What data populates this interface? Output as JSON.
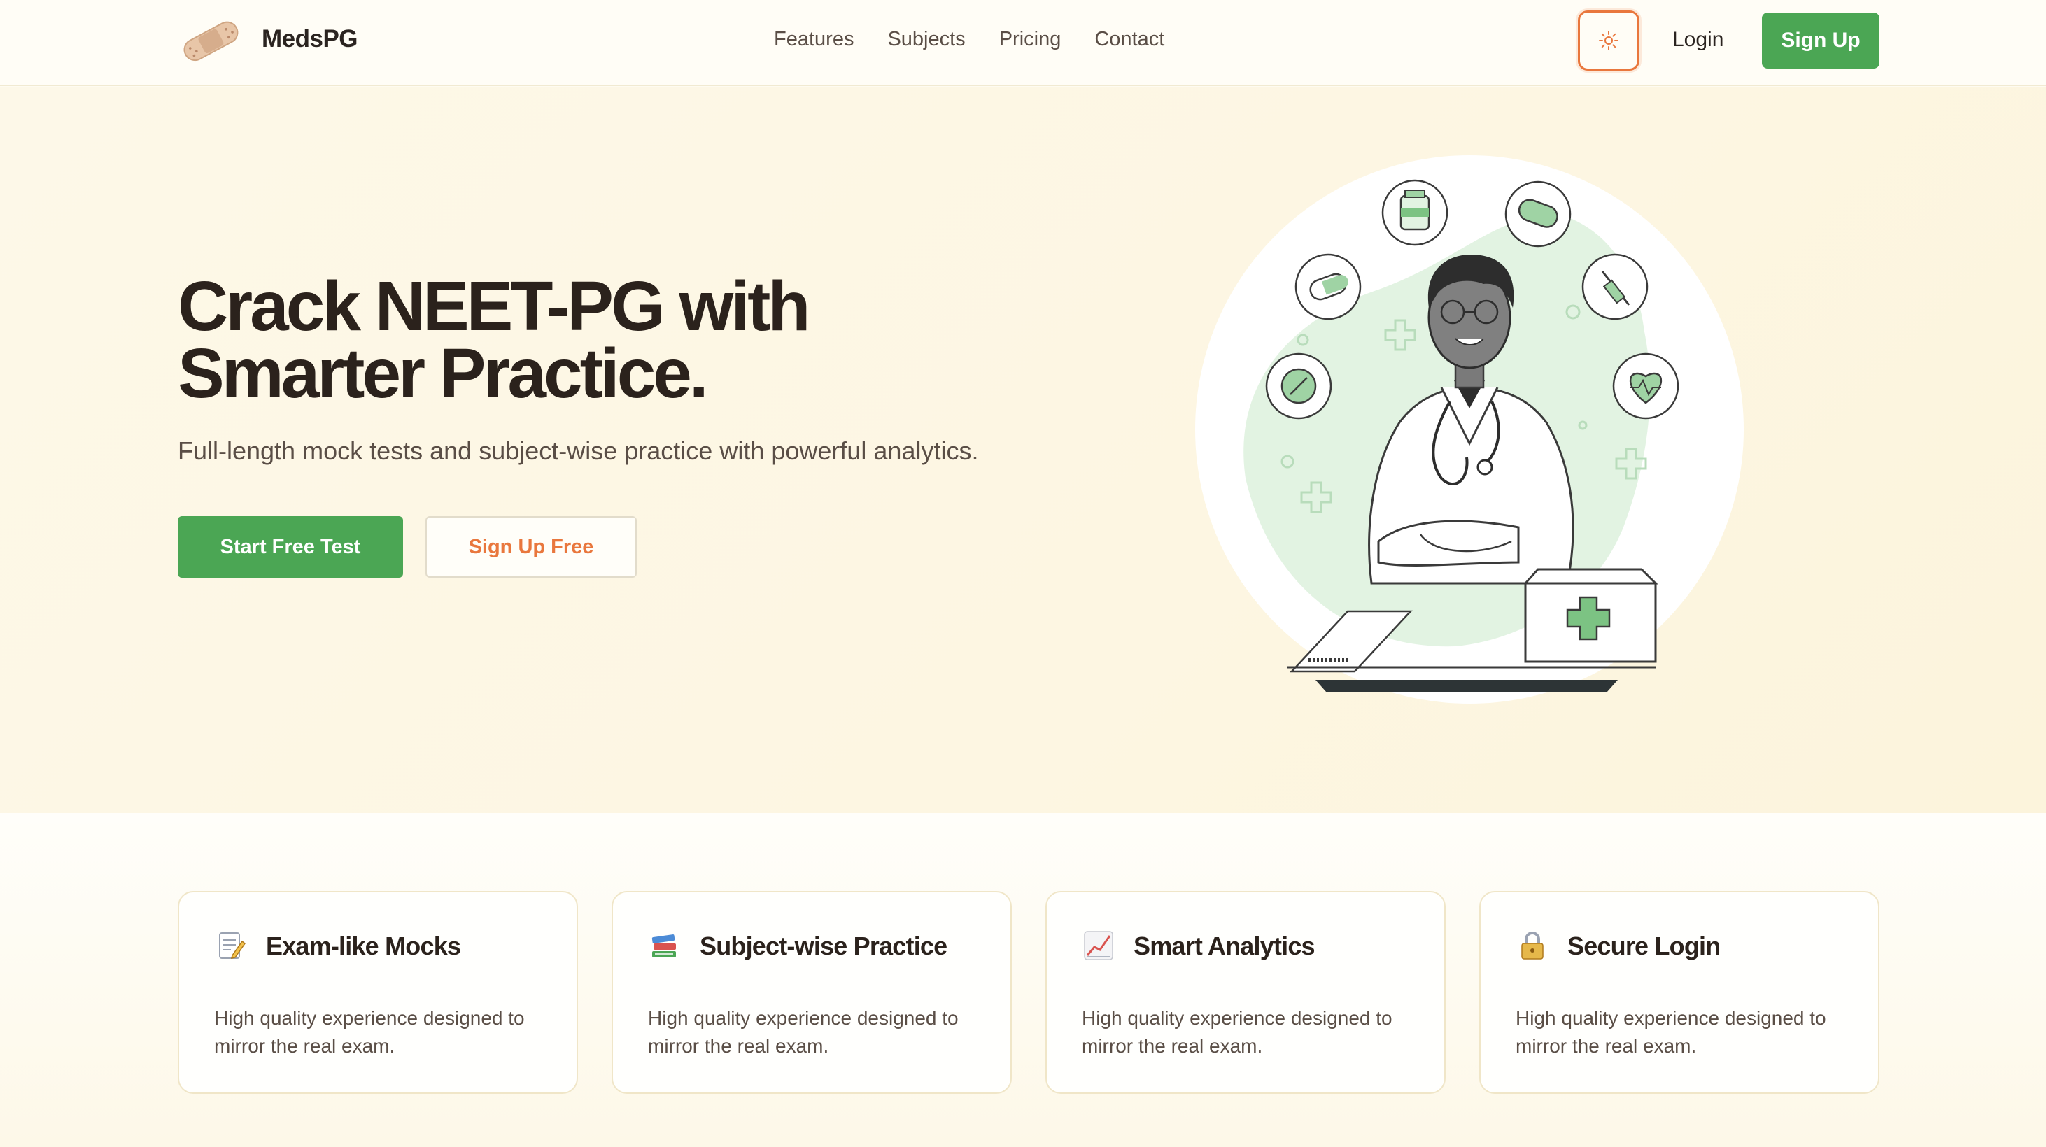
{
  "nav": {
    "brand": "MedsPG",
    "links": [
      "Features",
      "Subjects",
      "Pricing",
      "Contact"
    ],
    "login": "Login",
    "signup": "Sign Up",
    "theme_icon": "sun-icon"
  },
  "hero": {
    "title_line1": "Crack NEET-PG with",
    "title_line2": "Smarter Practice.",
    "subtitle": "Full-length mock tests and subject-wise practice with powerful analytics.",
    "primary_cta": "Start Free Test",
    "secondary_cta": "Sign Up Free"
  },
  "features": [
    {
      "icon": "memo-icon",
      "title": "Exam-like Mocks",
      "desc": "High quality experience designed to mirror the real exam."
    },
    {
      "icon": "books-icon",
      "title": "Subject-wise Practice",
      "desc": "High quality experience designed to mirror the real exam."
    },
    {
      "icon": "chart-icon",
      "title": "Smart Analytics",
      "desc": "High quality experience designed to mirror the real exam."
    },
    {
      "icon": "lock-icon",
      "title": "Secure Login",
      "desc": "High quality experience designed to mirror the real exam."
    }
  ],
  "colors": {
    "primary_green": "#4ba654",
    "accent_orange": "#e9773d",
    "background": "#fdf8e8",
    "text_dark": "#2b221c"
  }
}
